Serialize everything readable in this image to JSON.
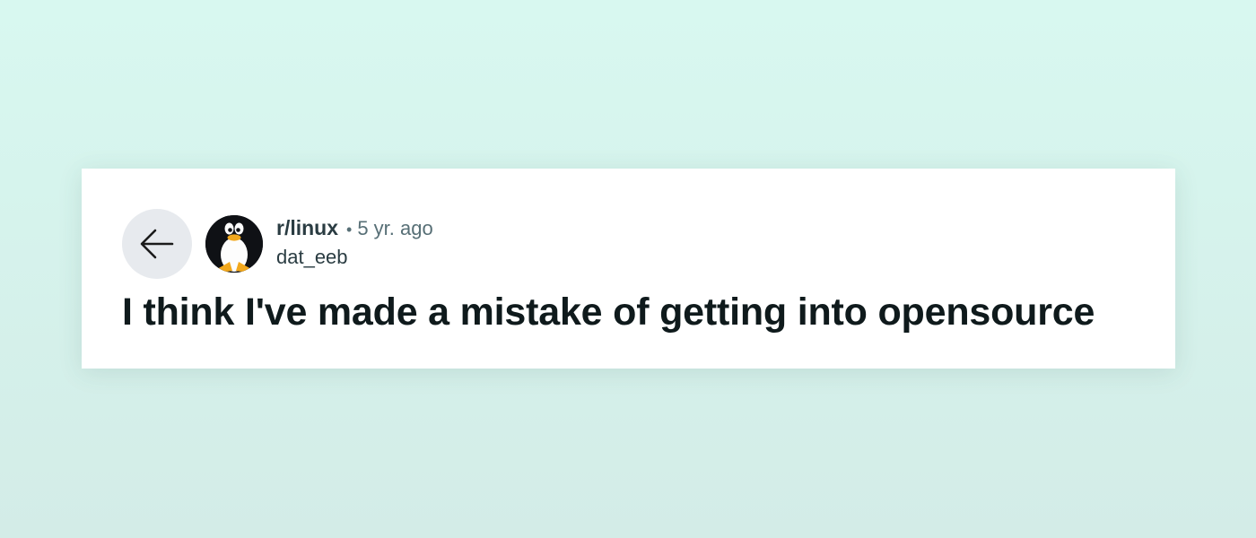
{
  "post": {
    "subreddit": "r/linux",
    "separator": "•",
    "time": "5 yr. ago",
    "author": "dat_eeb",
    "title": "I think I've made a mistake of getting into opensource"
  },
  "icons": {
    "back": "arrow-left-icon",
    "avatar": "tux-penguin-icon"
  },
  "colors": {
    "background_top": "#d8f8f0",
    "background_bottom": "#d3ece7",
    "card": "#ffffff",
    "back_button_bg": "#e7eaee",
    "title_text": "#0f1a1c",
    "meta_text": "#576f76"
  }
}
